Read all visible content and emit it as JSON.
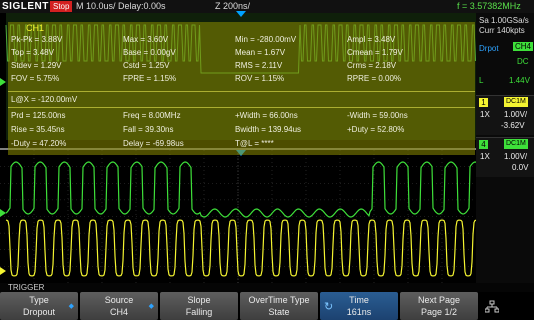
{
  "topbar": {
    "brand": "SIGLENT",
    "run_state": "Stop",
    "timebase": "M 10.0us/  Delay:0.00s",
    "zoom": "Z 200ns/",
    "frequency": "f = 3.57382MHz"
  },
  "measurements": {
    "channel": "CH1",
    "rows": [
      [
        "Pk-Pk = 3.88V",
        "Max = 3.60V",
        "Min = -280.00mV",
        "Ampl = 3.48V"
      ],
      [
        "Top = 3.48V",
        "Base = 0.00gV",
        "Mean = 1.67V",
        "Cmean = 1.79V"
      ],
      [
        "Stdev = 1.29V",
        "Cstd = 1.25V",
        "RMS = 2.11V",
        "Crms = 2.18V"
      ],
      [
        "FOV = 5.75%",
        "FPRE = 1.15%",
        "ROV = 1.15%",
        "RPRE = 0.00%"
      ],
      [
        "L@X = -120.00mV"
      ],
      [
        "Prd = 125.00ns",
        "Freq = 8.00MHz",
        "+Width = 66.00ns",
        "-Width = 59.00ns"
      ],
      [
        "Rise = 35.45ns",
        "Fall = 39.30ns",
        "Bwidth = 139.94us",
        "+Duty = 52.80%"
      ],
      [
        "-Duty = 47.20%",
        "Delay = -69.98us",
        "T@L = ****"
      ]
    ]
  },
  "acquisition": {
    "sample_rate": "Sa 1.00GSa/s",
    "memory": "Curr 140kpts",
    "drpot_label": "Drpot",
    "drpot_channel": "CH4",
    "drpot_coupling": "DC",
    "drpot_level_label": "L",
    "drpot_level": "1.44V"
  },
  "channels": [
    {
      "num": "1",
      "coupling": "DC1M",
      "probe": "1X",
      "scale": "1.00V/",
      "offset": "-3.62V",
      "color": "#f4f431"
    },
    {
      "num": "4",
      "coupling": "DC1M",
      "probe": "1X",
      "scale": "1.00V/",
      "offset": "0.0V",
      "color": "#3ee03a"
    }
  ],
  "menu": {
    "title": "TRIGGER",
    "keys": [
      {
        "line1": "Type",
        "line2": "Dropout",
        "arrow": true,
        "active": false
      },
      {
        "line1": "Source",
        "line2": "CH4",
        "arrow": true,
        "active": false
      },
      {
        "line1": "Slope",
        "line2": "Falling",
        "arrow": false,
        "active": false
      },
      {
        "line1": "OverTime Type",
        "line2": "State",
        "arrow": false,
        "active": false
      },
      {
        "line1": "Time",
        "line2": "161ns",
        "arrow": false,
        "active": true
      },
      {
        "line1": "Next Page",
        "line2": "Page 1/2",
        "arrow": false,
        "active": false
      }
    ]
  },
  "colors": {
    "ch1": "#f4f431",
    "ch4": "#3ee03a",
    "trigger": "#00a2ff",
    "stop": "#d32020"
  }
}
